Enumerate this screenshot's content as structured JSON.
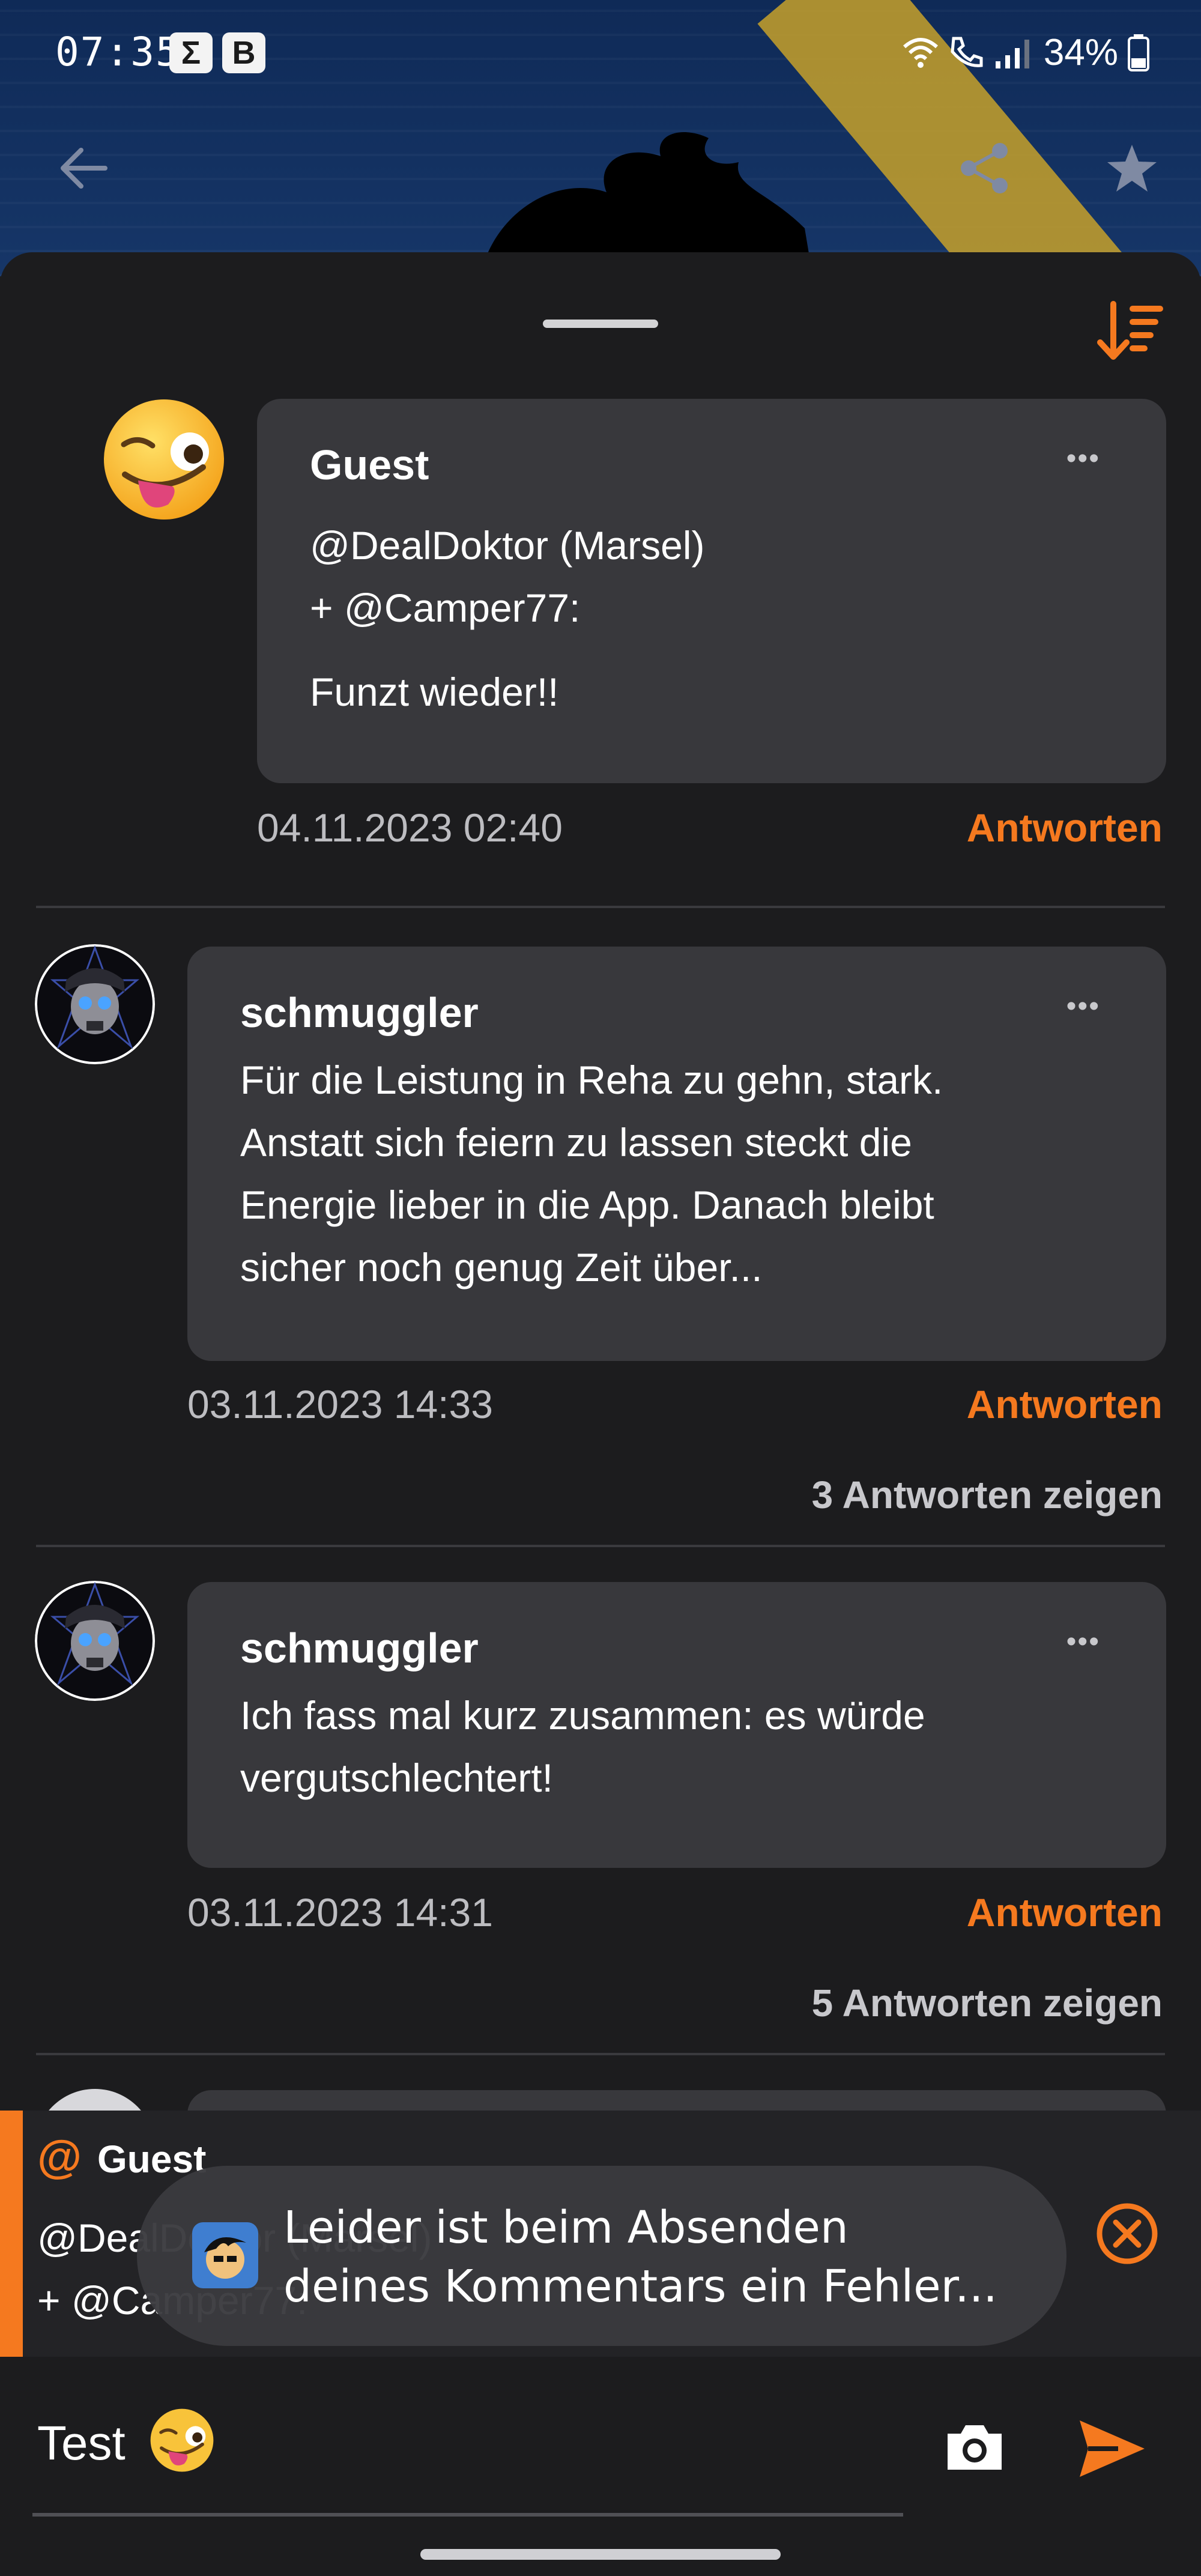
{
  "status_bar": {
    "time": "07:35",
    "badges": [
      "Σ",
      "B"
    ],
    "battery": "34%"
  },
  "app_bar": {
    "back_icon": "arrow-left-icon",
    "share_icon": "share-icon",
    "favorite_icon": "star-icon"
  },
  "sheet": {
    "sort_icon": "sort-descending-icon",
    "comments": [
      {
        "author": "Guest",
        "lines": [
          "@DealDoktor (Marsel)",
          "+ @Camper77:",
          "",
          "Funzt wieder!!"
        ],
        "date": "04.11.2023 02:40",
        "reply_label": "Antworten",
        "avatar": "winking-tongue-emoji"
      },
      {
        "author": "schmuggler",
        "lines": [
          "Für die Leistung in Reha zu gehn, stark.",
          "Anstatt sich feiern zu lassen steckt die",
          "Energie lieber in die App. Danach bleibt",
          "sicher noch genug Zeit über..."
        ],
        "date": "03.11.2023 14:33",
        "reply_label": "Antworten",
        "show_replies": "3 Antworten zeigen",
        "avatar": "skull-avatar"
      },
      {
        "author": "schmuggler",
        "lines": [
          "Ich fass mal kurz zusammen: es würde",
          "vergutschlechtert!"
        ],
        "date": "03.11.2023 14:31",
        "reply_label": "Antworten",
        "show_replies": "5 Antworten zeigen",
        "avatar": "skull-avatar"
      }
    ]
  },
  "reply_panel": {
    "at_symbol": "@",
    "name": "Guest",
    "quote_lines": [
      "@DealDoktor (Marsel)",
      "+ @Camper77:"
    ]
  },
  "toast": {
    "lines": [
      "Leider ist beim Absenden",
      "deines Kommentars ein Fehler..."
    ]
  },
  "composer": {
    "value": "Test",
    "emoji": "winking-tongue-emoji"
  },
  "colors": {
    "accent": "#f5791f",
    "bubble": "#38383c",
    "background": "#1c1c1e"
  }
}
